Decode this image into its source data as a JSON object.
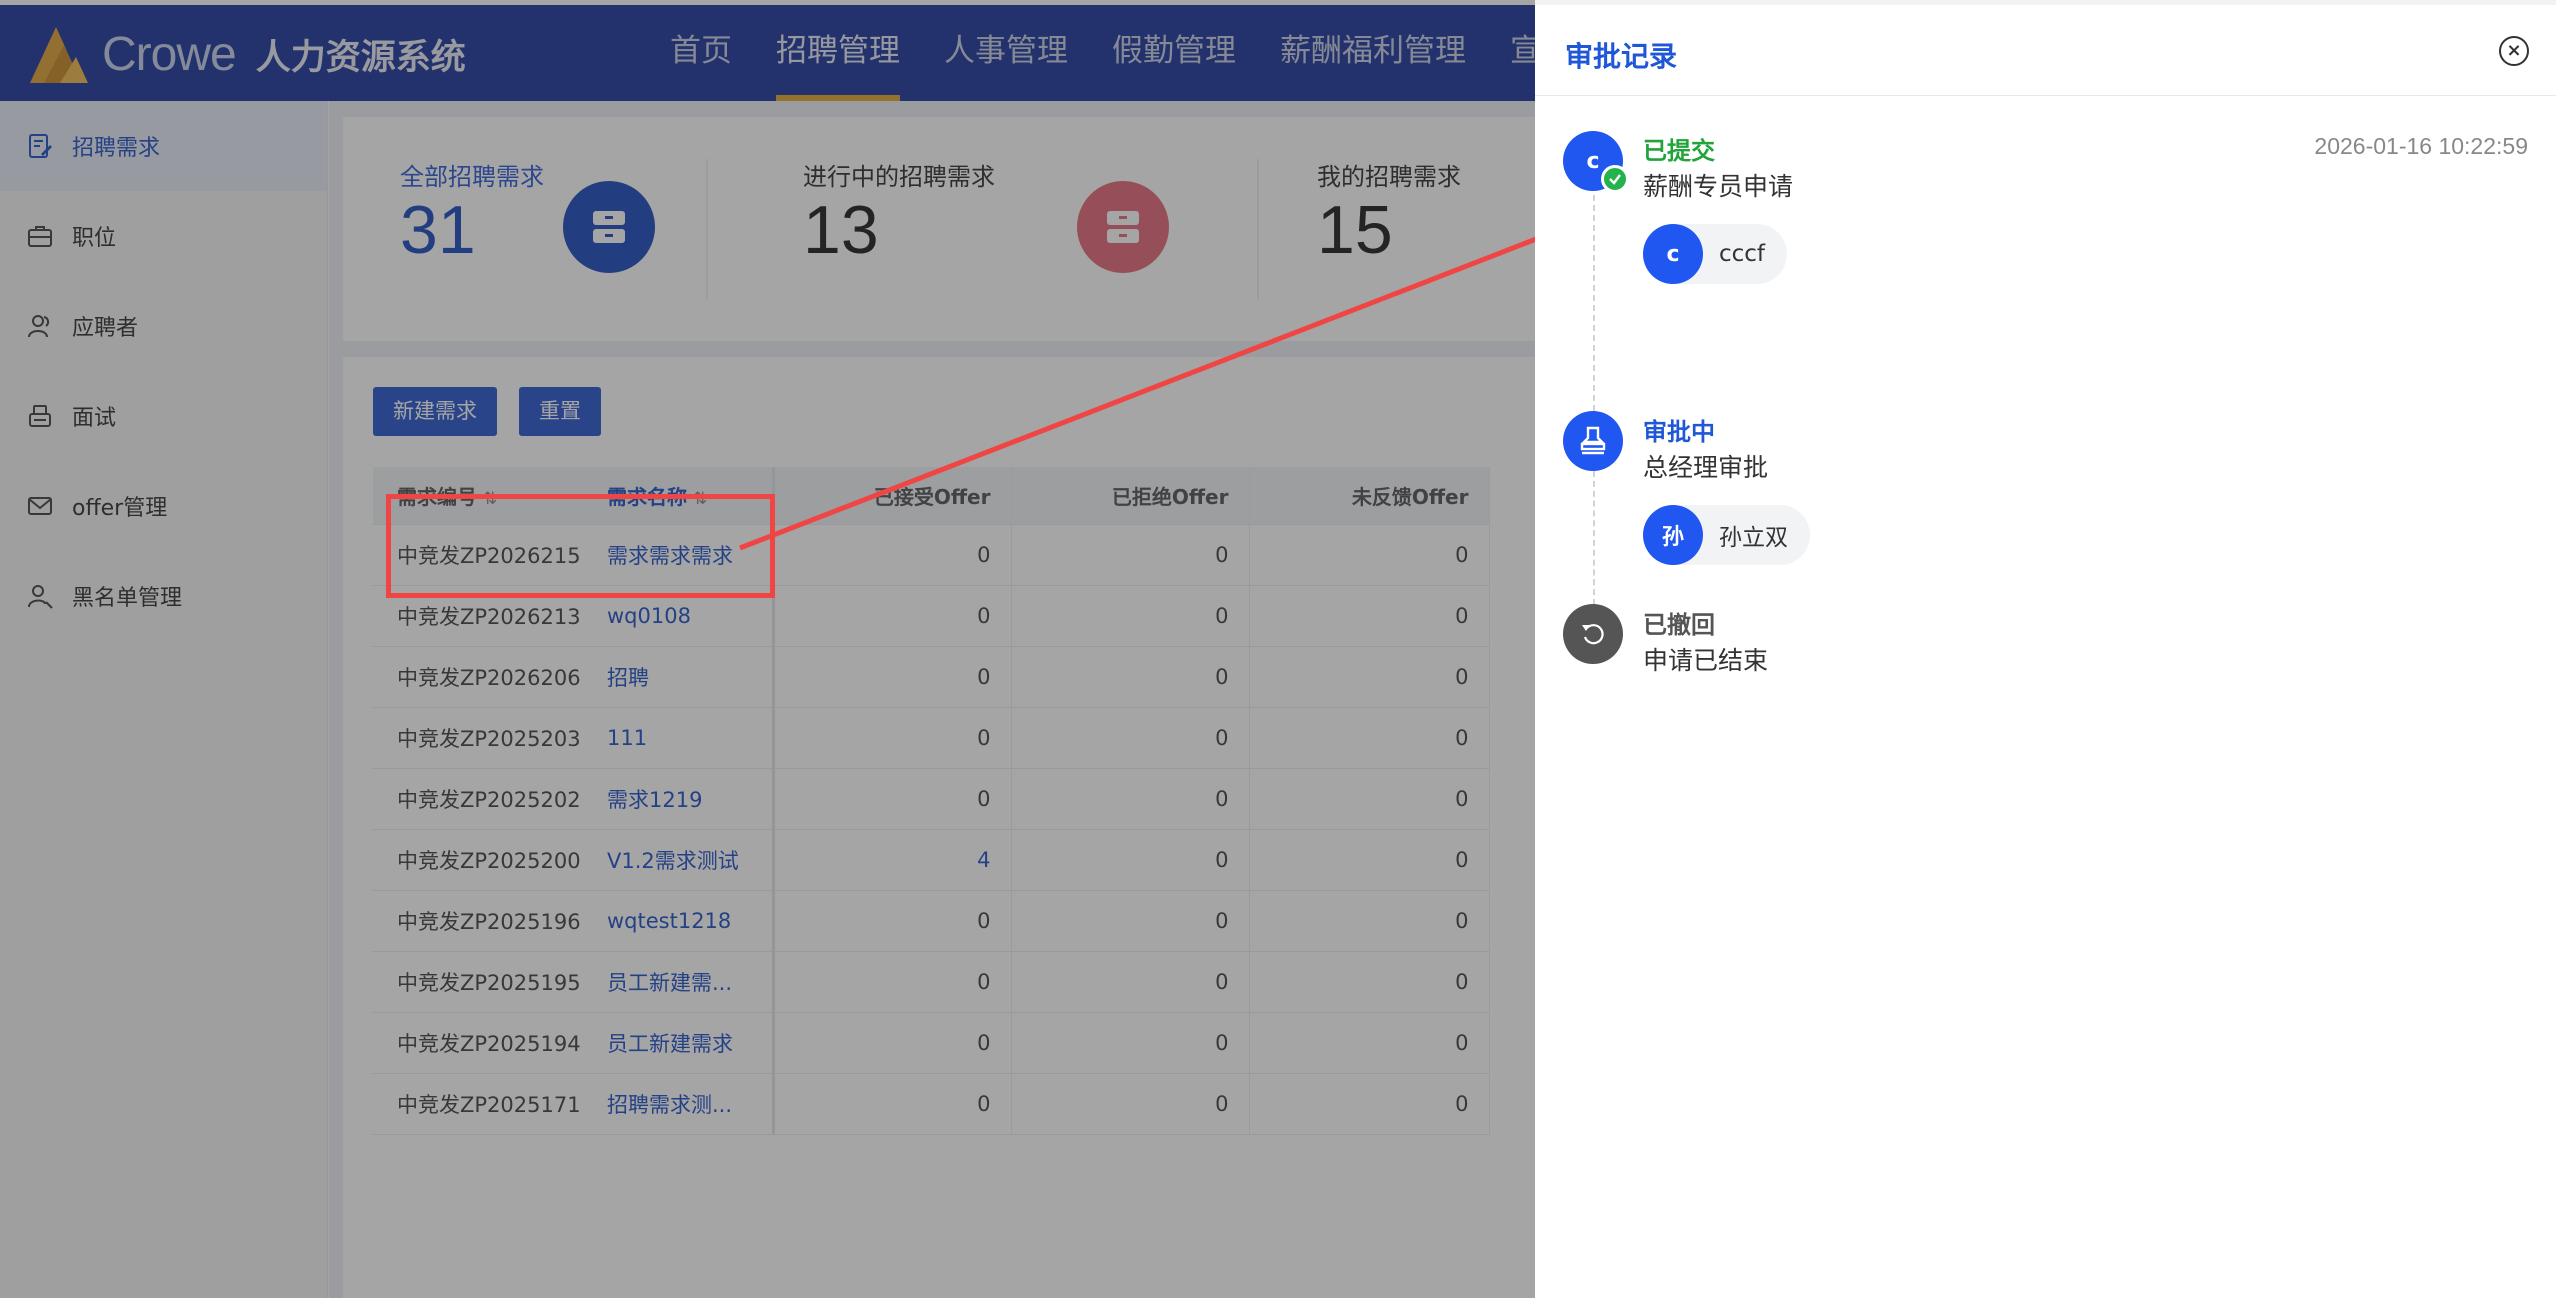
{
  "header": {
    "brand": "Crowe",
    "system_title": "人力资源系统",
    "nav": [
      {
        "label": "首页"
      },
      {
        "label": "招聘管理"
      },
      {
        "label": "人事管理"
      },
      {
        "label": "假勤管理"
      },
      {
        "label": "薪酬福利管理"
      },
      {
        "label": "宣"
      }
    ]
  },
  "sidebar": {
    "items": [
      {
        "label": "招聘需求",
        "icon": "edit-doc-icon"
      },
      {
        "label": "职位",
        "icon": "briefcase-icon"
      },
      {
        "label": "应聘者",
        "icon": "users-icon"
      },
      {
        "label": "面试",
        "icon": "interview-icon"
      },
      {
        "label": "offer管理",
        "icon": "mail-icon"
      },
      {
        "label": "黑名单管理",
        "icon": "user-block-icon"
      }
    ]
  },
  "stats": [
    {
      "label": "全部招聘需求",
      "value": "31",
      "color": "#2f5ed8"
    },
    {
      "label": "进行中的招聘需求",
      "value": "13",
      "color": "#e66c7a"
    },
    {
      "label": "我的招聘需求",
      "value": "15",
      "color": "#e8a34a"
    }
  ],
  "toolbar": {
    "new_label": "新建需求",
    "reset_label": "重置"
  },
  "table": {
    "headers": {
      "code": "需求编号",
      "name": "需求名称",
      "accepted": "已接受Offer",
      "rejected": "已拒绝Offer",
      "no_feedback": "未反馈Offer"
    },
    "rows": [
      {
        "code": "中竞发ZP2026215",
        "name": "需求需求需求",
        "accepted": "0",
        "rejected": "0",
        "no_feedback": "0"
      },
      {
        "code": "中竞发ZP2026213",
        "name": "wq0108",
        "accepted": "0",
        "rejected": "0",
        "no_feedback": "0"
      },
      {
        "code": "中竞发ZP2026206",
        "name": "招聘",
        "accepted": "0",
        "rejected": "0",
        "no_feedback": "0"
      },
      {
        "code": "中竞发ZP2025203",
        "name": "111",
        "accepted": "0",
        "rejected": "0",
        "no_feedback": "0"
      },
      {
        "code": "中竞发ZP2025202",
        "name": "需求1219",
        "accepted": "0",
        "rejected": "0",
        "no_feedback": "0"
      },
      {
        "code": "中竞发ZP2025200",
        "name": "V1.2需求测试",
        "accepted": "4",
        "rejected": "0",
        "no_feedback": "0"
      },
      {
        "code": "中竞发ZP2025196",
        "name": "wqtest1218",
        "accepted": "0",
        "rejected": "0",
        "no_feedback": "0"
      },
      {
        "code": "中竞发ZP2025195",
        "name": "员工新建需...",
        "accepted": "0",
        "rejected": "0",
        "no_feedback": "0"
      },
      {
        "code": "中竞发ZP2025194",
        "name": "员工新建需求",
        "accepted": "0",
        "rejected": "0",
        "no_feedback": "0"
      },
      {
        "code": "中竞发ZP2025171",
        "name": "招聘需求测...",
        "accepted": "0",
        "rejected": "0",
        "no_feedback": "0"
      }
    ]
  },
  "drawer": {
    "title": "审批记录",
    "timeline": [
      {
        "avatar": "c",
        "status": "已提交",
        "status_color": "#22a43a",
        "desc": "薪酬专员申请",
        "time": "2026-01-16 10:22:59",
        "person_avatar": "c",
        "person": "cccf"
      },
      {
        "status": "审批中",
        "status_color": "#1f57d6",
        "desc": "总经理审批",
        "person_avatar": "孙",
        "person": "孙立双"
      },
      {
        "status": "已撤回",
        "status_color": "#555555",
        "desc": "申请已结束"
      }
    ]
  }
}
